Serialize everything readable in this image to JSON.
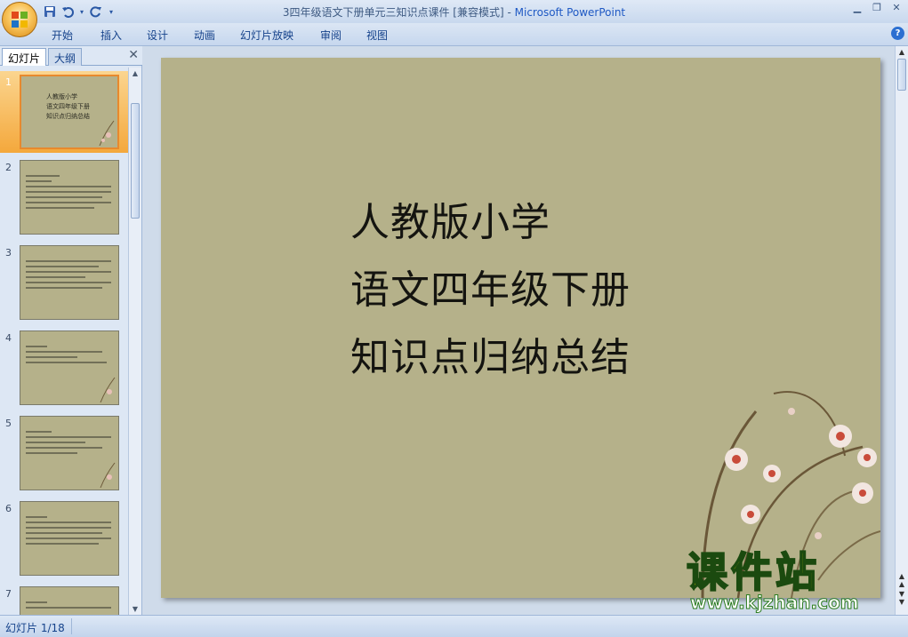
{
  "window": {
    "title_doc": "3四年级语文下册单元三知识点课件 [兼容模式]",
    "title_sep": " - ",
    "title_app": "Microsoft PowerPoint"
  },
  "qat": {
    "save_icon": "save-icon",
    "undo_icon": "undo-icon",
    "redo_icon": "repeat-icon"
  },
  "ribbon": {
    "tabs": [
      "开始",
      "插入",
      "设计",
      "动画",
      "幻灯片放映",
      "审阅",
      "视图"
    ]
  },
  "pane": {
    "tabs": [
      "幻灯片",
      "大纲"
    ],
    "slide_numbers": [
      "1",
      "2",
      "3",
      "4",
      "5",
      "6",
      "7"
    ],
    "thumb1_lines": [
      "人教版小学",
      "语文四年级下册",
      "知识点归纳总结"
    ]
  },
  "slide": {
    "lines": [
      "人教版小学",
      "语文四年级下册",
      "知识点归纳总结"
    ],
    "background": "#b5b18a"
  },
  "watermark": {
    "text": "课件站",
    "url": "www.kjzhan.com"
  },
  "status": {
    "slide_indicator": "幻灯片 1/18"
  },
  "colors": {
    "accent_selected": "#f4a83c",
    "ribbon_text": "#15428b"
  }
}
